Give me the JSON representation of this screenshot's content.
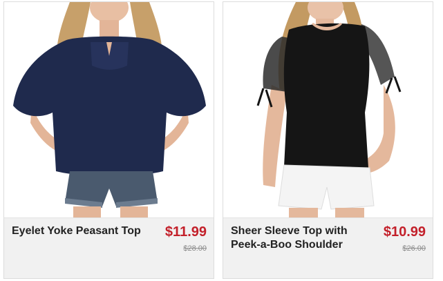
{
  "products": [
    {
      "name": "Eyelet Yoke Peasant Top",
      "price": "$11.99",
      "was_price": "$28.00",
      "image": "navy-peasant-top-photo",
      "colors": {
        "garment": "#1f2a4d",
        "shorts": "#4a5a6e"
      }
    },
    {
      "name": "Sheer Sleeve Top with Peek-a-Boo Shoulder",
      "price": "$10.99",
      "was_price": "$26.00",
      "image": "black-sheer-sleeve-top-photo",
      "colors": {
        "garment": "#151515",
        "shorts": "#f4f4f4"
      }
    }
  ],
  "colors": {
    "price": "#c3202a",
    "info_bg": "#f1f1f1"
  }
}
